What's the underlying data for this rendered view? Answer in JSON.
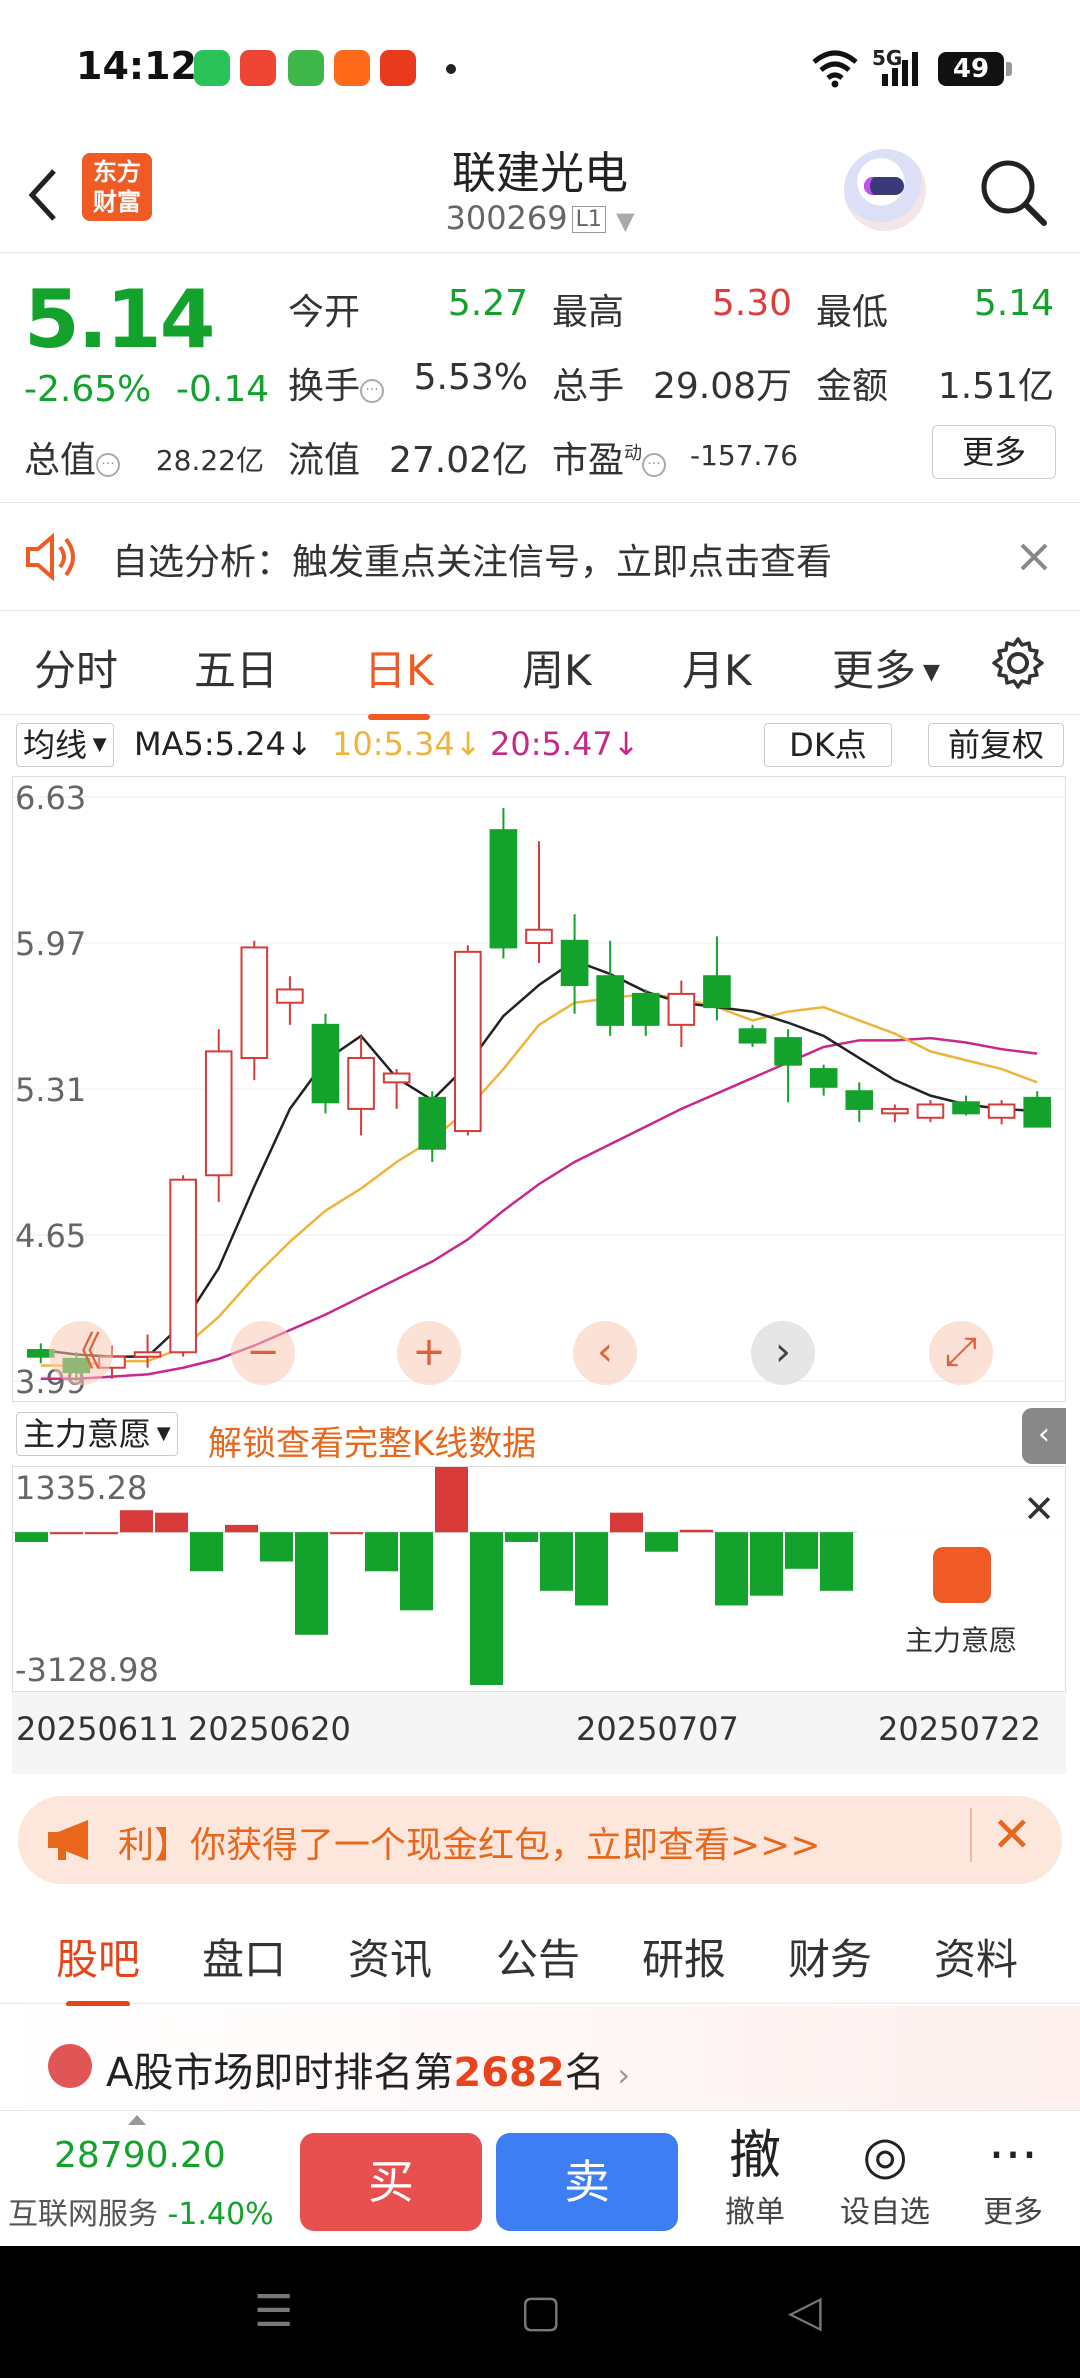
{
  "status_bar": {
    "time": "14:12",
    "network": "5G",
    "battery": "49"
  },
  "header": {
    "logo": "东方\n财富",
    "title": "联建光电",
    "code": "300269",
    "level": "L1"
  },
  "quote": {
    "price": "5.14",
    "change_pct": "-2.65%",
    "change": "-0.14",
    "fields": [
      {
        "label": "今开",
        "value": "5.27",
        "color": "#13a32c"
      },
      {
        "label": "最高",
        "value": "5.30",
        "color": "#e03c3c"
      },
      {
        "label": "最低",
        "value": "5.14",
        "color": "#13a32c"
      },
      {
        "label": "换手",
        "value": "5.53%",
        "color": "#333333"
      },
      {
        "label": "总手",
        "value": "29.08万",
        "color": "#333333"
      },
      {
        "label": "金额",
        "value": "1.51亿",
        "color": "#333333"
      },
      {
        "label": "总值",
        "value": "28.22亿",
        "color": "#333333"
      },
      {
        "label": "流值",
        "value": "27.02亿",
        "color": "#333333"
      },
      {
        "label": "市盈",
        "value": "-157.76",
        "color": "#333333"
      }
    ],
    "pe_superscript": "动",
    "more_label": "更多"
  },
  "banner": {
    "text": "自选分析：触发重点关注信号，立即点击查看"
  },
  "tabs": [
    "分时",
    "五日",
    "日K",
    "周K",
    "月K",
    "更多"
  ],
  "active_tab": "日K",
  "ma_bar": {
    "select": "均线",
    "ma5": "MA5:5.24↓",
    "ma10": "10:5.34↓",
    "ma20": "20:5.47↓",
    "dk": "DK点",
    "adjust": "前复权",
    "ma5_color": "#222222",
    "ma10_color": "#f0b43a",
    "ma20_color": "#c8288a"
  },
  "chart_data": [
    {
      "type": "candlestick",
      "y_ticks": [
        "6.63",
        "5.97",
        "5.31",
        "4.65",
        "3.99"
      ],
      "ylim": [
        3.99,
        6.63
      ],
      "candles": [
        {
          "o": 4.13,
          "h": 4.16,
          "l": 4.07,
          "c": 4.1
        },
        {
          "o": 4.09,
          "h": 4.12,
          "l": 3.99,
          "c": 4.03
        },
        {
          "o": 4.05,
          "h": 4.15,
          "l": 4.0,
          "c": 4.1
        },
        {
          "o": 4.1,
          "h": 4.2,
          "l": 4.05,
          "c": 4.12
        },
        {
          "o": 4.12,
          "h": 4.92,
          "l": 4.1,
          "c": 4.9
        },
        {
          "o": 4.92,
          "h": 5.58,
          "l": 4.8,
          "c": 5.48
        },
        {
          "o": 5.45,
          "h": 5.98,
          "l": 5.35,
          "c": 5.95
        },
        {
          "o": 5.7,
          "h": 5.82,
          "l": 5.6,
          "c": 5.76
        },
        {
          "o": 5.6,
          "h": 5.65,
          "l": 5.2,
          "c": 5.25
        },
        {
          "o": 5.22,
          "h": 5.55,
          "l": 5.1,
          "c": 5.45
        },
        {
          "o": 5.34,
          "h": 5.4,
          "l": 5.22,
          "c": 5.38
        },
        {
          "o": 5.27,
          "h": 5.3,
          "l": 4.98,
          "c": 5.04
        },
        {
          "o": 5.12,
          "h": 5.96,
          "l": 5.1,
          "c": 5.93
        },
        {
          "o": 6.48,
          "h": 6.58,
          "l": 5.9,
          "c": 5.95
        },
        {
          "o": 5.97,
          "h": 6.43,
          "l": 5.88,
          "c": 6.03
        },
        {
          "o": 5.98,
          "h": 6.1,
          "l": 5.65,
          "c": 5.78
        },
        {
          "o": 5.82,
          "h": 5.98,
          "l": 5.55,
          "c": 5.6
        },
        {
          "o": 5.74,
          "h": 5.76,
          "l": 5.55,
          "c": 5.6
        },
        {
          "o": 5.6,
          "h": 5.8,
          "l": 5.5,
          "c": 5.74
        },
        {
          "o": 5.82,
          "h": 6.0,
          "l": 5.62,
          "c": 5.68
        },
        {
          "o": 5.58,
          "h": 5.6,
          "l": 5.5,
          "c": 5.52
        },
        {
          "o": 5.54,
          "h": 5.58,
          "l": 5.25,
          "c": 5.42
        },
        {
          "o": 5.4,
          "h": 5.42,
          "l": 5.28,
          "c": 5.32
        },
        {
          "o": 5.3,
          "h": 5.34,
          "l": 5.16,
          "c": 5.22
        },
        {
          "o": 5.2,
          "h": 5.24,
          "l": 5.16,
          "c": 5.22
        },
        {
          "o": 5.18,
          "h": 5.26,
          "l": 5.16,
          "c": 5.24
        },
        {
          "o": 5.25,
          "h": 5.28,
          "l": 5.19,
          "c": 5.2
        },
        {
          "o": 5.18,
          "h": 5.26,
          "l": 5.15,
          "c": 5.24
        },
        {
          "o": 5.27,
          "h": 5.3,
          "l": 5.14,
          "c": 5.14
        }
      ],
      "ma5": [
        4.13,
        4.11,
        4.1,
        4.1,
        4.25,
        4.5,
        4.87,
        5.22,
        5.44,
        5.55,
        5.36,
        5.26,
        5.42,
        5.64,
        5.78,
        5.89,
        5.83,
        5.75,
        5.7,
        5.68,
        5.66,
        5.61,
        5.55,
        5.45,
        5.35,
        5.28,
        5.24,
        5.22,
        5.21
      ],
      "ma10": [
        4.06,
        4.06,
        4.08,
        4.08,
        4.14,
        4.28,
        4.46,
        4.62,
        4.76,
        4.86,
        4.98,
        5.08,
        5.22,
        5.4,
        5.6,
        5.7,
        5.72,
        5.74,
        5.72,
        5.68,
        5.62,
        5.66,
        5.68,
        5.62,
        5.56,
        5.48,
        5.44,
        5.4,
        5.34
      ],
      "ma20": [
        4.0,
        4.0,
        4.01,
        4.02,
        4.05,
        4.09,
        4.15,
        4.22,
        4.29,
        4.37,
        4.45,
        4.53,
        4.63,
        4.76,
        4.88,
        4.98,
        5.06,
        5.14,
        5.22,
        5.29,
        5.36,
        5.43,
        5.5,
        5.53,
        5.53,
        5.54,
        5.52,
        5.49,
        5.47
      ]
    },
    {
      "type": "bar",
      "name": "主力意愿",
      "y_ticks": [
        "1335.28",
        "-3128.98"
      ],
      "ylim": [
        -3128.98,
        1335.28
      ],
      "values": [
        -200,
        0,
        0,
        450,
        400,
        -800,
        150,
        -600,
        -2100,
        0,
        -800,
        -1600,
        1335,
        -3129,
        -200,
        -1200,
        -1500,
        400,
        -400,
        50,
        -1500,
        -1300,
        -750,
        -1200
      ]
    }
  ],
  "chart_controls": [
    "《",
    "−",
    "+",
    "‹",
    "›",
    "⤢"
  ],
  "indicator": {
    "select": "主力意愿",
    "unlock": "解锁查看完整K线数据",
    "card_label": "主力意愿"
  },
  "dates": [
    "20250611",
    "20250620",
    "20250707",
    "20250722"
  ],
  "promo": {
    "text": "利】你获得了一个现金红包，立即查看>>>"
  },
  "bottom_tabs": [
    "股吧",
    "盘口",
    "资讯",
    "公告",
    "研报",
    "财务",
    "资料"
  ],
  "rank": {
    "prefix": "A股市场即时排名第",
    "number": "2682",
    "suffix": "名"
  },
  "trade": {
    "index_value": "28790.20",
    "index_name": "互联网服务",
    "index_change": "-1.40%",
    "buy": "买",
    "sell": "卖",
    "actions": [
      {
        "icon": "撤",
        "label": "撤单"
      },
      {
        "icon": "◎",
        "label": "设自选"
      },
      {
        "icon": "···",
        "label": "更多"
      }
    ]
  }
}
